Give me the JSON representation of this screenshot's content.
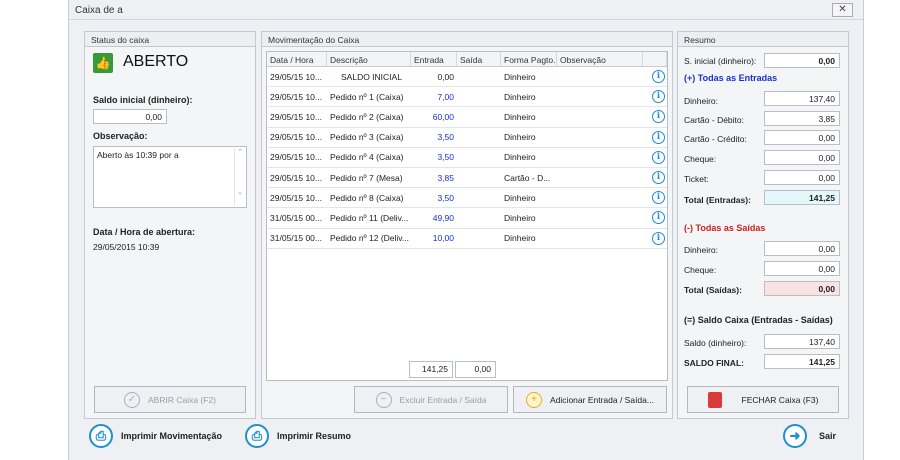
{
  "window": {
    "title": "Caixa de a",
    "close": "✕"
  },
  "status": {
    "header": "Status do caixa",
    "state": "ABERTO",
    "saldo_label": "Saldo inicial (dinheiro):",
    "saldo_value": "0,00",
    "obs_label": "Observação:",
    "obs_value": "Aberto às 10:39 por a",
    "data_label": "Data / Hora de abertura:",
    "data_value": "29/05/2015 10:39",
    "open_button": "ABRIR Caixa (F2)"
  },
  "mov": {
    "header": "Movimentação do Caixa",
    "columns": [
      "Data / Hora",
      "Descrição",
      "Entrada",
      "Saída",
      "Forma Pagto.",
      "Observação"
    ],
    "rows": [
      {
        "date": "29/05/15 10...",
        "desc": "SALDO INICIAL",
        "entrada": "0,00",
        "forma": "Dinheiro"
      },
      {
        "date": "29/05/15 10...",
        "desc": "Pedido nº 1 (Caixa)",
        "entrada": "7,00",
        "forma": "Dinheiro"
      },
      {
        "date": "29/05/15 10...",
        "desc": "Pedido nº 2 (Caixa)",
        "entrada": "60,00",
        "forma": "Dinheiro"
      },
      {
        "date": "29/05/15 10...",
        "desc": "Pedido nº 3 (Caixa)",
        "entrada": "3,50",
        "forma": "Dinheiro"
      },
      {
        "date": "29/05/15 10...",
        "desc": "Pedido nº 4 (Caixa)",
        "entrada": "3,50",
        "forma": "Dinheiro"
      },
      {
        "date": "29/05/15 10...",
        "desc": "Pedido nº 7 (Mesa)",
        "entrada": "3,85",
        "forma": "Cartão - D..."
      },
      {
        "date": "29/05/15 10...",
        "desc": "Pedido nº 8 (Caixa)",
        "entrada": "3,50",
        "forma": "Dinheiro"
      },
      {
        "date": "31/05/15 00...",
        "desc": "Pedido nº 11 (Deliv...",
        "entrada": "49,90",
        "forma": "Dinheiro"
      },
      {
        "date": "31/05/15 00...",
        "desc": "Pedido nº 12 (Deliv...",
        "entrada": "10,00",
        "forma": "Dinheiro"
      }
    ],
    "total_entrada": "141,25",
    "total_saida": "0,00",
    "excluir_button": "Excluir Entrada / Saída",
    "adicionar_button": "Adicionar Entrada / Saída..."
  },
  "resumo": {
    "header": "Resumo",
    "s_inicial_label": "S. inicial (dinheiro):",
    "s_inicial_value": "0,00",
    "entradas_title": "(+) Todas as Entradas",
    "dinheiro_label": "Dinheiro:",
    "dinheiro_value": "137,40",
    "debito_label": "Cartão - Débito:",
    "debito_value": "3,85",
    "credito_label": "Cartão - Crédito:",
    "credito_value": "0,00",
    "cheque_label": "Cheque:",
    "cheque_value": "0,00",
    "ticket_label": "Ticket:",
    "ticket_value": "0,00",
    "total_entradas_label": "Total (Entradas):",
    "total_entradas_value": "141,25",
    "saidas_title": "(-) Todas as Saídas",
    "s_dinheiro_label": "Dinheiro:",
    "s_dinheiro_value": "0,00",
    "s_cheque_label": "Cheque:",
    "s_cheque_value": "0,00",
    "total_saidas_label": "Total (Saídas):",
    "total_saidas_value": "0,00",
    "saldo_title": "(=) Saldo Caixa (Entradas - Saídas)",
    "saldo_dinheiro_label": "Saldo (dinheiro):",
    "saldo_dinheiro_value": "137,40",
    "saldo_final_label": "SALDO FINAL:",
    "saldo_final_value": "141,25",
    "fechar_button": "FECHAR Caixa (F3)"
  },
  "footer": {
    "imprimir_mov": "Imprimir Movimentação",
    "imprimir_resumo": "Imprimir Resumo",
    "sair": "Sair"
  },
  "colors": {
    "accent_blue": "#1b2fd0",
    "entradas_title": "#1b2fd0",
    "saidas_title": "#cc2222",
    "total_entradas_bg": "#e4f8fb",
    "total_saidas_bg": "#fbe2e2",
    "status_green": "#3a9a3a"
  }
}
